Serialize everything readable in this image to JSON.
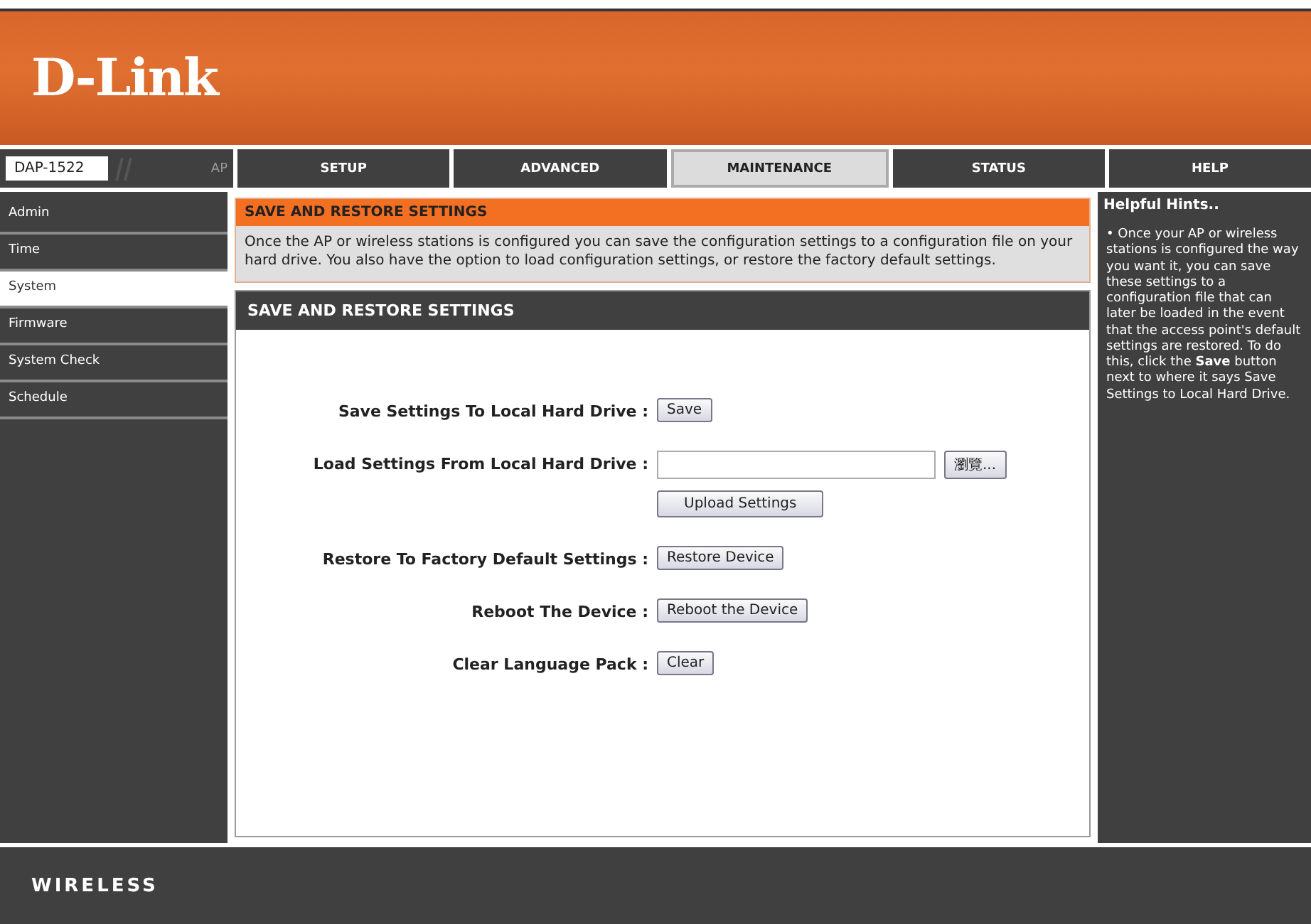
{
  "brand": {
    "logo": "D-Link"
  },
  "model": {
    "name": "DAP-1522",
    "mode": "AP"
  },
  "tabs": [
    {
      "label": "SETUP",
      "selected": false
    },
    {
      "label": "ADVANCED",
      "selected": false
    },
    {
      "label": "MAINTENANCE",
      "selected": true
    },
    {
      "label": "STATUS",
      "selected": false
    },
    {
      "label": "HELP",
      "selected": false
    }
  ],
  "sidebar": {
    "items": [
      {
        "label": "Admin",
        "selected": false
      },
      {
        "label": "Time",
        "selected": false
      },
      {
        "label": "System",
        "selected": true
      },
      {
        "label": "Firmware",
        "selected": false
      },
      {
        "label": "System Check",
        "selected": false
      },
      {
        "label": "Schedule",
        "selected": false
      }
    ]
  },
  "intro": {
    "title": "SAVE AND RESTORE SETTINGS",
    "text": "Once the AP or wireless stations is configured you can save the configuration settings to a configuration file on your hard drive. You also have the option to load configuration settings, or restore the factory default settings."
  },
  "section": {
    "title": "SAVE AND RESTORE SETTINGS",
    "rows": [
      {
        "label": "Save Settings To Local Hard Drive :",
        "controls": [
          {
            "kind": "button",
            "label": "Save"
          }
        ]
      },
      {
        "label": "Load Settings From Local Hard Drive :",
        "controls": [
          {
            "kind": "file",
            "label": "瀏覽..."
          },
          {
            "kind": "button",
            "label": "Upload Settings"
          }
        ]
      },
      {
        "label": "Restore To Factory Default Settings :",
        "controls": [
          {
            "kind": "button",
            "label": "Restore Device"
          }
        ]
      },
      {
        "label": "Reboot The Device :",
        "controls": [
          {
            "kind": "button",
            "label": "Reboot the Device"
          }
        ]
      },
      {
        "label": "Clear Language Pack :",
        "controls": [
          {
            "kind": "button",
            "label": "Clear"
          }
        ]
      }
    ]
  },
  "hints": {
    "title": "Helpful Hints..",
    "text": "• Once your AP or wireless stations is configured the way you want it, you can save these settings to a configuration file that can later be loaded in the event that the access point's default settings are restored. To do this, click the **Save** button next to where it says Save Settings to Local Hard Drive."
  },
  "footer": {
    "label": "WIRELESS"
  }
}
